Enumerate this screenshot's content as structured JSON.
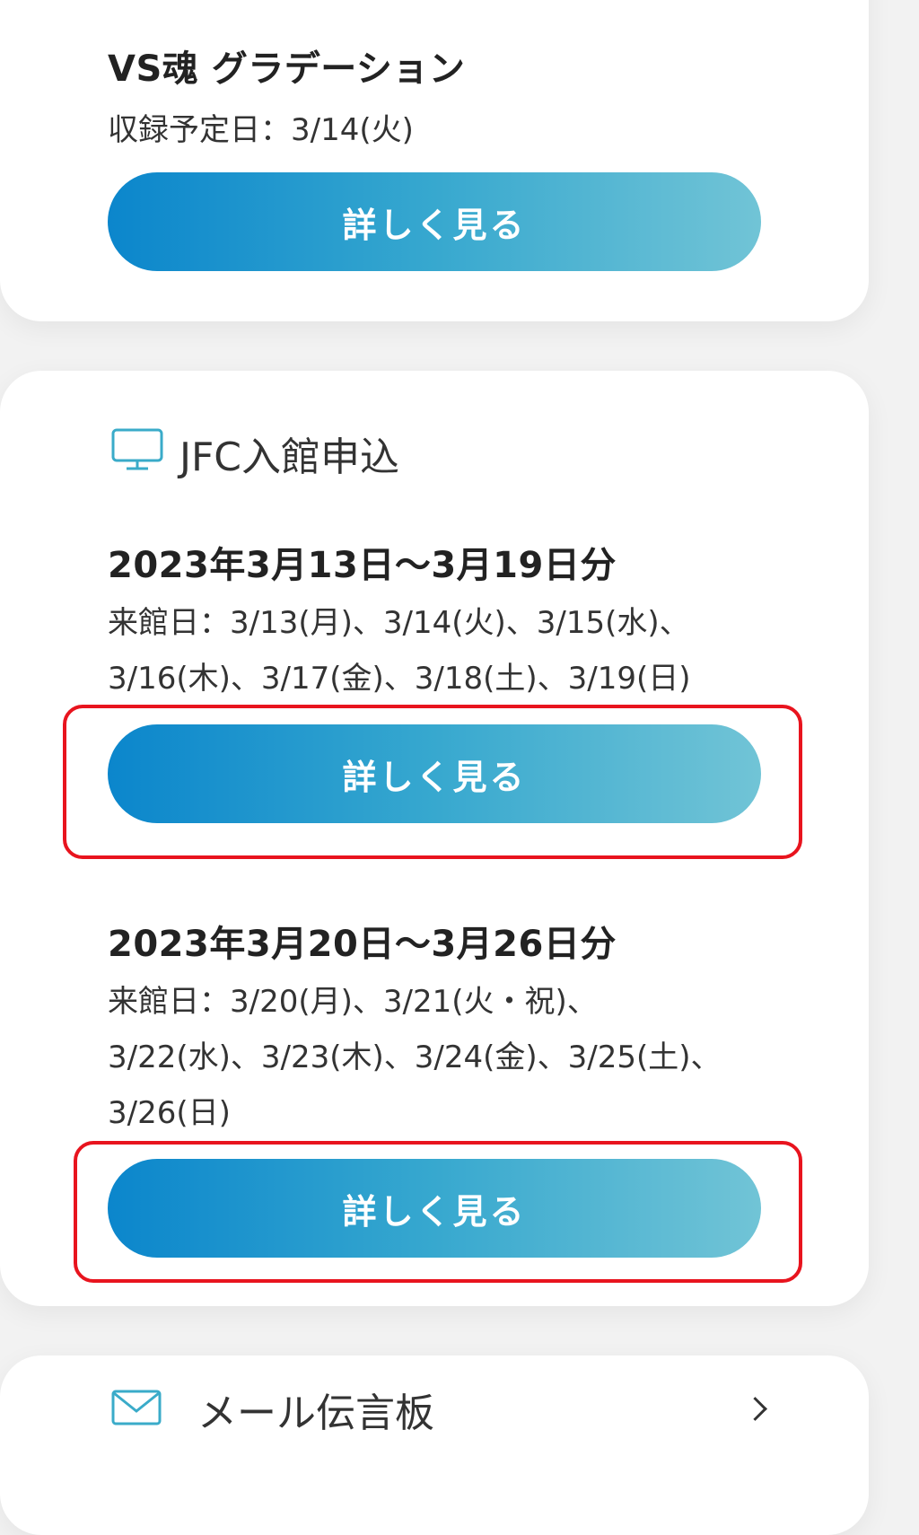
{
  "prev_item": {
    "title": "VS魂 グラデーション",
    "date_line": "収録予定日：3/14(火)",
    "button_label": "詳しく見る"
  },
  "jfc": {
    "section_title": "JFC入館申込",
    "icon": "monitor-icon",
    "items": [
      {
        "title": "2023年3月13日〜3月19日分",
        "lines": [
          "来館日：3/13(月)、3/14(火)、3/15(水)、",
          "3/16(木)、3/17(金)、3/18(土)、3/19(日)"
        ],
        "button_label": "詳しく見る"
      },
      {
        "title": "2023年3月20日〜3月26日分",
        "lines": [
          "来館日：3/20(月)、3/21(火・祝)、",
          "3/22(水)、3/23(木)、3/24(金)、3/25(土)、",
          "3/26(日)"
        ],
        "button_label": "詳しく見る"
      }
    ]
  },
  "mail": {
    "title": "メール伝言板",
    "icon": "mail-icon",
    "chevron": "chevron-right-icon"
  },
  "colors": {
    "accent_start": "#0b86cc",
    "accent_end": "#71c4d6",
    "highlight": "#e8141e",
    "icon": "#3aabc9"
  }
}
